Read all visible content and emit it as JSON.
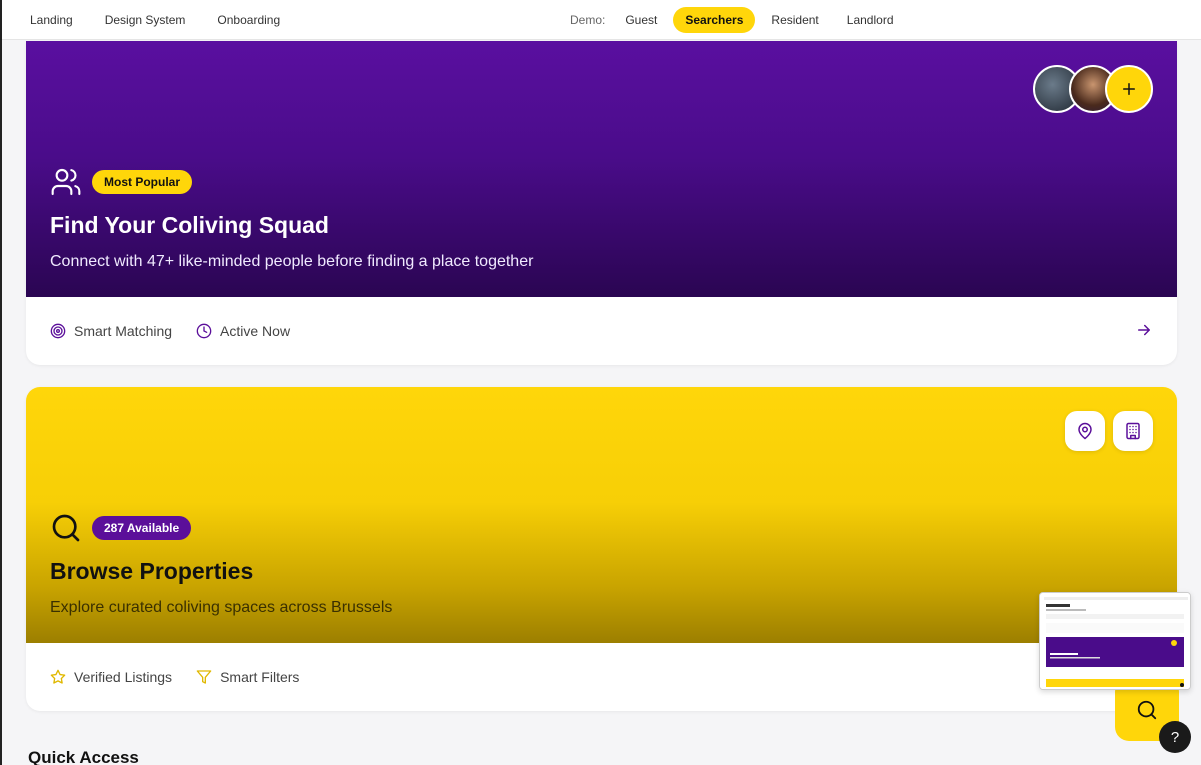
{
  "nav": {
    "left": [
      "Landing",
      "Design System",
      "Onboarding"
    ],
    "demo_label": "Demo:",
    "demo_options": [
      "Guest",
      "Searchers",
      "Resident",
      "Landlord"
    ],
    "demo_active": "Searchers"
  },
  "squad_card": {
    "badge": "Most Popular",
    "title": "Find Your Coliving Squad",
    "subtitle": "Connect with 47+ like-minded people before finding a place together",
    "features": [
      "Smart Matching",
      "Active Now"
    ],
    "icon": "users-icon",
    "colors": {
      "gradient_top": "#5a0fa0",
      "gradient_bottom": "#2a0552",
      "accent": "#ffd60a"
    }
  },
  "browse_card": {
    "badge": "287 Available",
    "title": "Browse Properties",
    "subtitle": "Explore curated coliving spaces across Brussels",
    "features": [
      "Verified Listings",
      "Smart Filters"
    ],
    "icon": "search-icon",
    "colors": {
      "gradient_top": "#ffd60a",
      "gradient_bottom": "#9c7f00",
      "badge": "#5b0f9a"
    }
  },
  "section": {
    "quick_access": "Quick Access"
  },
  "help": {
    "label": "?"
  },
  "accent": "#5b0f9a"
}
